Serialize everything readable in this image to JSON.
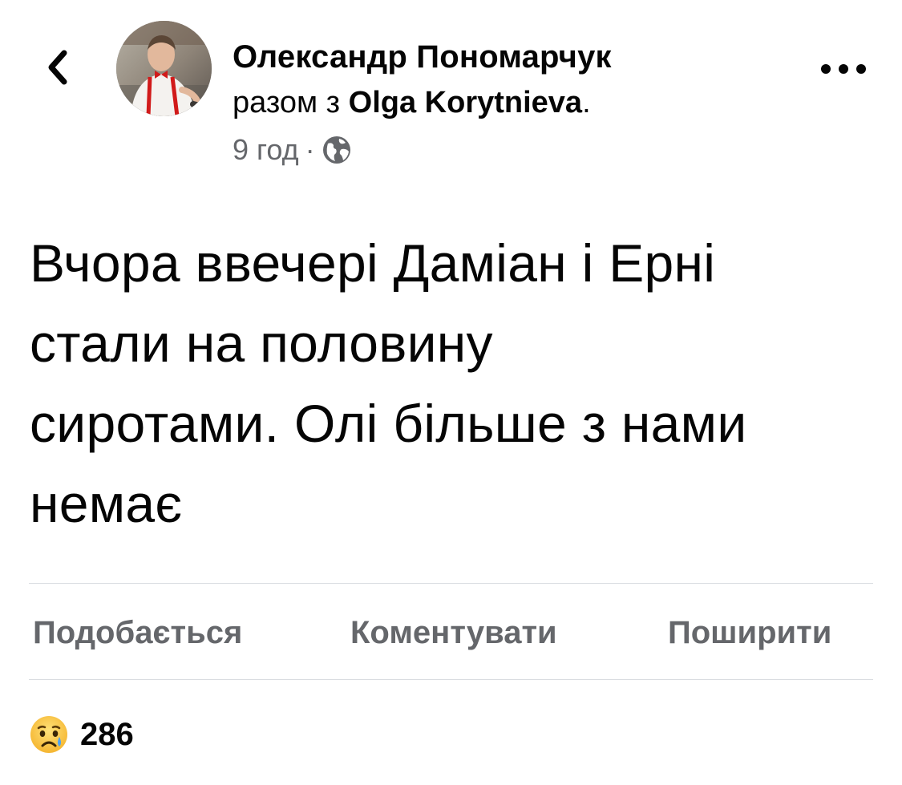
{
  "post": {
    "author": "Олександр Пономарчук",
    "with_prefix": "разом з",
    "tagged_user": "Olga Korytnieva",
    "tagged_suffix": ".",
    "time": "9 год",
    "separator": "·",
    "audience_icon": "globe-icon",
    "text_lines": [
      "Вчора ввечері Даміан і Ерні",
      "стали на половину",
      "сиротами. Олі більше з нами",
      "немає"
    ]
  },
  "nav": {
    "back_icon": "chevron-left-icon",
    "more_icon": "more-horizontal-icon"
  },
  "actions": {
    "like": "Подобається",
    "comment": "Коментувати",
    "share": "Поширити"
  },
  "reactions": {
    "icon": "sad-reaction-icon",
    "count": "286"
  }
}
